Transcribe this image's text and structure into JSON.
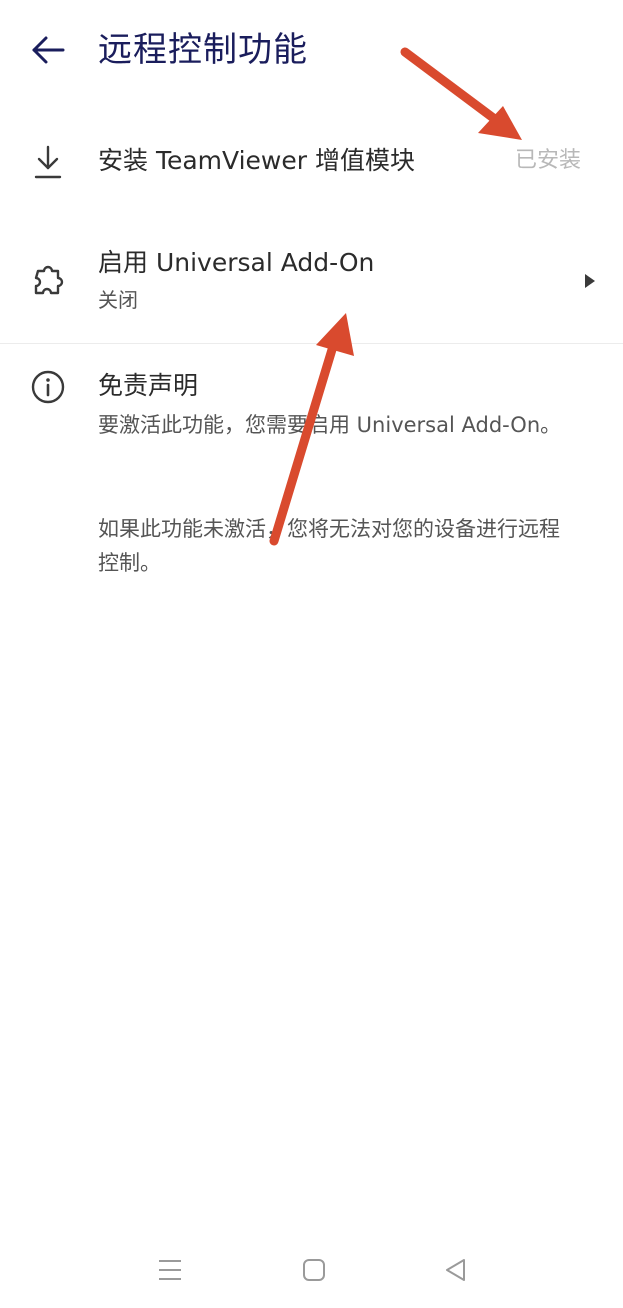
{
  "header": {
    "title": "远程控制功能",
    "back_icon": "back-arrow-icon"
  },
  "install_row": {
    "icon": "download-icon",
    "label": "安装 TeamViewer 增值模块",
    "status": "已安装"
  },
  "addon_row": {
    "icon": "puzzle-icon",
    "label": "启用 Universal Add-On",
    "sublabel": "关闭",
    "chevron_icon": "play-triangle-icon"
  },
  "disclaimer": {
    "icon": "info-icon",
    "title": "免责声明",
    "paragraph1": "要激活此功能，您需要启用 Universal Add-On。",
    "paragraph2": "如果此功能未激活，您将无法对您的设备进行远程控制。"
  },
  "annotation_color": "#d94a2e",
  "navigation": {
    "menu_icon": "menu-lines-icon",
    "home_icon": "home-square-icon",
    "back_icon": "back-triangle-icon"
  }
}
